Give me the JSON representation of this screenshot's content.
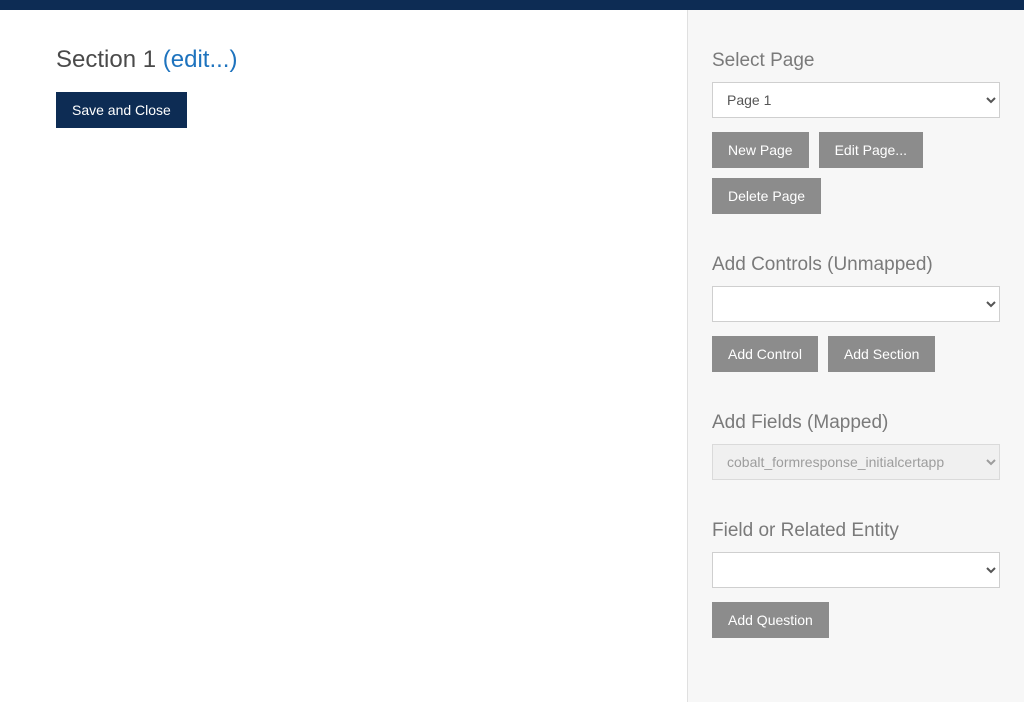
{
  "main": {
    "section_title": "Section 1",
    "edit_link": "(edit...)",
    "save_close_label": "Save and Close"
  },
  "side": {
    "select_page": {
      "label": "Select Page",
      "value": "Page 1",
      "buttons": {
        "new_page": "New Page",
        "edit_page": "Edit Page...",
        "delete_page": "Delete Page"
      }
    },
    "add_controls": {
      "label": "Add Controls (Unmapped)",
      "value": "",
      "buttons": {
        "add_control": "Add Control",
        "add_section": "Add Section"
      }
    },
    "add_fields": {
      "label": "Add Fields (Mapped)",
      "value": "cobalt_formresponse_initialcertapp"
    },
    "related_entity": {
      "label": "Field or Related Entity",
      "value": "",
      "buttons": {
        "add_question": "Add Question"
      }
    }
  }
}
